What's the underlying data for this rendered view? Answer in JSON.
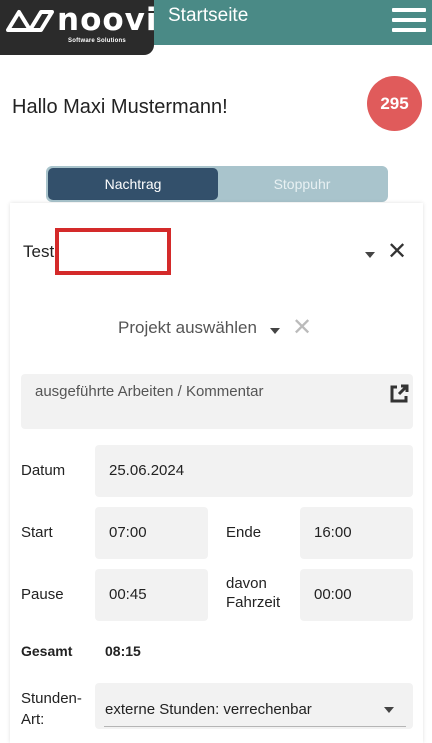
{
  "header": {
    "logo_text": "noovi",
    "logo_subtitle": "Software Solutions",
    "title": "Startseite",
    "menu_icon": "hamburger-menu-icon",
    "background_color": "#4a8a86"
  },
  "greeting": {
    "text": "Hallo Maxi Mustermann!",
    "badge_count": "295",
    "badge_color": "#e05b5b"
  },
  "tabs": [
    {
      "label": "Nachtrag",
      "active": true
    },
    {
      "label": "Stoppuhr",
      "active": false
    }
  ],
  "form": {
    "task_select": {
      "label": "Test",
      "value": ""
    },
    "project_select": {
      "placeholder": "Projekt auswählen"
    },
    "comment": {
      "placeholder": "ausgeführte Arbeiten / Kommentar",
      "icon": "external-link-icon"
    },
    "date": {
      "label": "Datum",
      "value": "25.06.2024"
    },
    "start": {
      "label": "Start",
      "value": "07:00"
    },
    "end": {
      "label": "Ende",
      "value": "16:00"
    },
    "pause": {
      "label": "Pause",
      "value": "00:45"
    },
    "travel": {
      "label_line1": "davon",
      "label_line2": "Fahrzeit",
      "value": "00:00"
    },
    "total": {
      "label": "Gesamt",
      "value": "08:15"
    },
    "hour_type": {
      "label_line1": "Stunden-",
      "label_line2": "Art:",
      "value": "externe Stunden: verrechenbar"
    }
  }
}
